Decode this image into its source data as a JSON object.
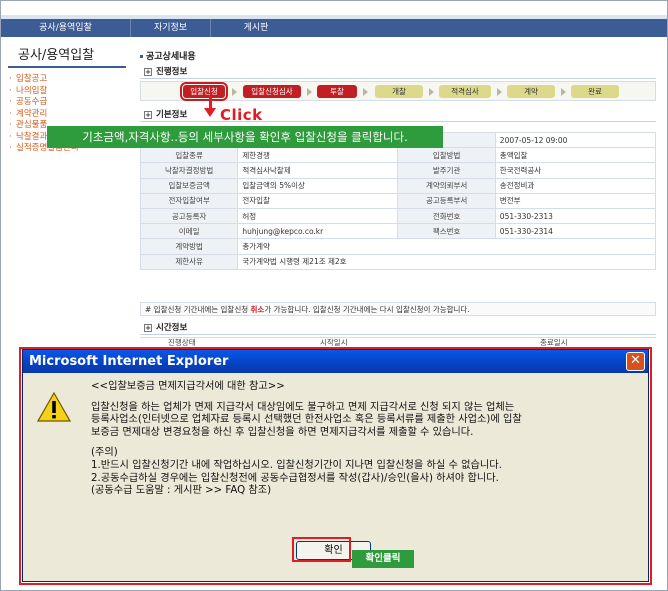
{
  "topnav": {
    "items": [
      "공사/용역입찰",
      "자기정보",
      "게시판"
    ]
  },
  "sidebar": {
    "title": "공사/용역입찰",
    "items": [
      "입찰공고",
      "나의입찰",
      "공동수급",
      "계약관리",
      "관심물품",
      "낙찰결과",
      "실적증명발급관리"
    ]
  },
  "main": {
    "section_title": "공고상세내용",
    "progress_title": "진행정보",
    "steps": [
      "입찰신청",
      "입찰신청심사",
      "투찰",
      "개찰",
      "적격심사",
      "계약",
      "완료"
    ],
    "basic_title": "기본정보",
    "rows": [
      [
        "",
        "",
        "",
        "2007-05-12 09:00"
      ],
      [
        "입찰종류",
        "제한경쟁",
        "입찰방법",
        "총액입찰"
      ],
      [
        "낙찰자결정방법",
        "적격심사낙찰제",
        "발주기관",
        "한국전력공사"
      ],
      [
        "입찰보증금액",
        "입찰금액의 5%이상",
        "계약의뢰부서",
        "송전정비과"
      ],
      [
        "전자입찰여부",
        "전자입찰",
        "공고등록부서",
        "변전부"
      ],
      [
        "공고등록자",
        "허정",
        "전화번호",
        "051-330-2313"
      ],
      [
        "이메일",
        "huhjung@kepco.co.kr",
        "팩스번호",
        "051-330-2314"
      ],
      [
        "계약방법",
        "총가계약",
        "",
        ""
      ],
      [
        "제한사유",
        "국가계약법 시행령 제21조 제2호",
        "",
        ""
      ]
    ],
    "notice_pre": "# 입찰신청 기간내에는 입찰신청 ",
    "notice_red": "취소",
    "notice_post": "가 가능합니다.  입찰신청 기간내에는 다시 입찰신청이 가능합니다.",
    "time_title": "시간정보",
    "time_cols": [
      "진행상태",
      "시작일시",
      "종료일시"
    ]
  },
  "annotation": {
    "click": "Click",
    "banner": "기초금액,자격사항..등의 세부사항을 확인후 입찰신청을 클릭합니다.",
    "ok_label": "확인클릭"
  },
  "dialog": {
    "title": "Microsoft Internet Explorer",
    "close_glyph": "✕",
    "heading": "<<입찰보증금 면제지급각서에 대한 참고>>",
    "para1": "입찰신청을 하는 업체가 면제 지급각서 대상임에도 불구하고 면제 지급각서로 신청 되지 않는 업체는\n등록사업소(인터넷으로 업체자료 등록시 선택했던 한전사업소 혹은 등록서류를 제출한 사업소)에 입찰\n보증금 면제대상 변경요청을 하신 후 입찰신청을 하면 면제지급각서를 제출할 수 있습니다.",
    "para2": "(주의)\n1.반드시 입찰신청기간 내에 작업하십시오. 입찰신청기간이 지나면 입찰신청을 하실 수 없습니다.\n2.공동수급하실 경우에는 입찰신청전에 공동수급협정서를 작성(갑사)/승인(을사) 하셔야 합니다.\n  (공동수급 도움말 : 게시판 >> FAQ 참조)",
    "ok_button": "확인"
  }
}
